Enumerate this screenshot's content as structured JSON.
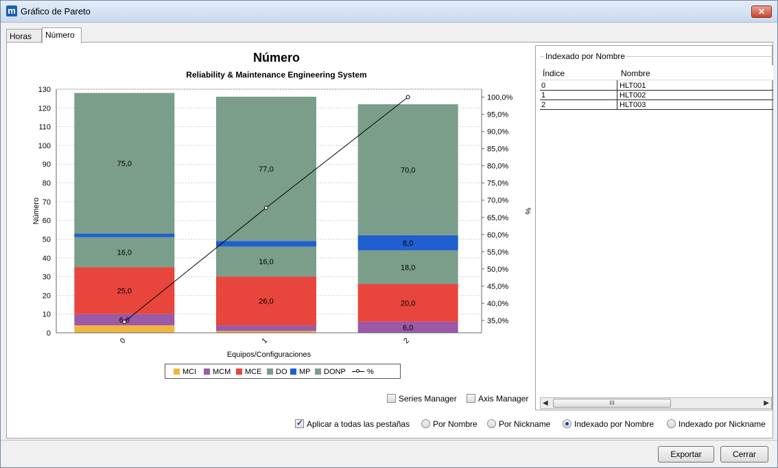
{
  "window": {
    "title": "Gráfico de Pareto",
    "app_icon": "m",
    "close_glyph": "✕"
  },
  "tabs": [
    {
      "label": "Horas",
      "active": false
    },
    {
      "label": "Número",
      "active": true
    }
  ],
  "chart_data": {
    "type": "bar",
    "title": "Número",
    "subtitle": "Reliability & Maintenance Engineering System",
    "xlabel": "Equipos/Configuraciones",
    "ylabel": "Número",
    "y2label": "%",
    "categories": [
      "0",
      "1",
      "2"
    ],
    "ylim": [
      0,
      130
    ],
    "yticks": [
      0,
      10,
      20,
      30,
      40,
      50,
      60,
      70,
      80,
      90,
      100,
      110,
      120,
      130
    ],
    "y2lim": [
      31.4,
      102.3
    ],
    "y2ticks": [
      "35,0%",
      "40,0%",
      "45,0%",
      "50,0%",
      "55,0%",
      "60,0%",
      "65,0%",
      "70,0%",
      "75,0%",
      "80,0%",
      "85,0%",
      "90,0%",
      "95,0%",
      "100,0%"
    ],
    "y2tick_values": [
      35,
      40,
      45,
      50,
      55,
      60,
      65,
      70,
      75,
      80,
      85,
      90,
      95,
      100
    ],
    "stacked": true,
    "series": [
      {
        "name": "MCI",
        "color": "#f0b541",
        "values": [
          4,
          1,
          0
        ],
        "labels": [
          "",
          "",
          ""
        ]
      },
      {
        "name": "MCM",
        "color": "#9b59a8",
        "values": [
          6,
          3,
          6
        ],
        "labels": [
          "6,0",
          "",
          "6,0"
        ]
      },
      {
        "name": "MCE",
        "color": "#e8463c",
        "values": [
          25,
          26,
          20
        ],
        "labels": [
          "25,0",
          "26,0",
          "20,0"
        ]
      },
      {
        "name": "DO",
        "color": "#7a9e8a",
        "values": [
          16,
          16,
          18
        ],
        "labels": [
          "16,0",
          "16,0",
          "18,0"
        ]
      },
      {
        "name": "MP",
        "color": "#1f5fd0",
        "values": [
          2,
          3,
          8
        ],
        "labels": [
          "",
          "",
          "8,0"
        ]
      },
      {
        "name": "DONP",
        "color": "#7a9e8a",
        "values": [
          75,
          77,
          70
        ],
        "labels": [
          "75,0",
          "77,0",
          "70,0"
        ]
      }
    ],
    "line": {
      "name": "%",
      "color": "#000000",
      "values": [
        34.6,
        67.8,
        100.0
      ]
    },
    "grid": true,
    "legend": "bottom-center"
  },
  "controls": {
    "series_manager": "Series Manager",
    "axis_manager": "Axis Manager",
    "apply_all": "Aplicar a todas las pestañas",
    "por_nombre": "Por Nombre",
    "por_nickname": "Por Nickname",
    "indexado_nombre": "Indexado por Nombre",
    "indexado_nickname": "Indexado por Nickname"
  },
  "index_panel": {
    "group_title": "Indexado por Nombre",
    "headers": {
      "indice": "Índice",
      "nombre": "Nombre"
    },
    "rows": [
      {
        "indice": "0",
        "nombre": "HLT001"
      },
      {
        "indice": "1",
        "nombre": "HLT002"
      },
      {
        "indice": "2",
        "nombre": "HLT003"
      }
    ],
    "scroll_grip": "III",
    "scroll_left": "◀",
    "scroll_right": "▶"
  },
  "buttons": {
    "exportar": "Exportar",
    "cerrar": "Cerrar"
  }
}
